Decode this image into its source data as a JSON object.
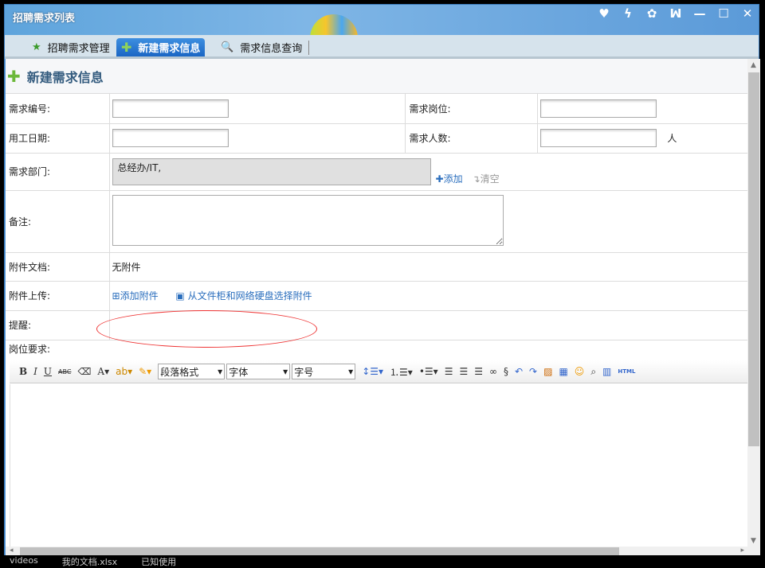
{
  "window": {
    "title": "招聘需求列表",
    "controls": [
      "♥",
      "ϟ",
      "✿",
      "ꟽ",
      "—",
      "☐",
      "✕"
    ]
  },
  "tabs": [
    {
      "label": "招聘需求管理",
      "icon": "star-icon"
    },
    {
      "label": "新建需求信息",
      "icon": "plus-icon"
    },
    {
      "label": "需求信息查询",
      "icon": "search-icon"
    }
  ],
  "page": {
    "title": "新建需求信息"
  },
  "form": {
    "req_no_label": "需求编号:",
    "req_no_value": "",
    "position_label": "需求岗位:",
    "position_value": "",
    "date_label": "用工日期:",
    "date_value": "",
    "count_label": "需求人数:",
    "count_value": "",
    "count_unit": "人",
    "dept_label": "需求部门:",
    "dept_value": "总经办/IT,",
    "dept_add": "添加",
    "dept_clear": "清空",
    "remark_label": "备注:",
    "remark_value": "",
    "docs_label": "附件文档:",
    "docs_value": "无附件",
    "upload_label": "附件上传:",
    "upload_add": "添加附件",
    "upload_cabinet": "从文件柜和网络硬盘选择附件",
    "remind_label": "提醒:",
    "requirements_label": "岗位要求:"
  },
  "editor": {
    "bold": "B",
    "italic": "I",
    "underline": "U",
    "strike": "ABC",
    "font_color": "A",
    "paragraph": "段落格式",
    "font": "字体",
    "size": "字号",
    "html": "HTML"
  },
  "taskbar": [
    "videos",
    "我的文档.xlsx",
    "已知使用"
  ]
}
